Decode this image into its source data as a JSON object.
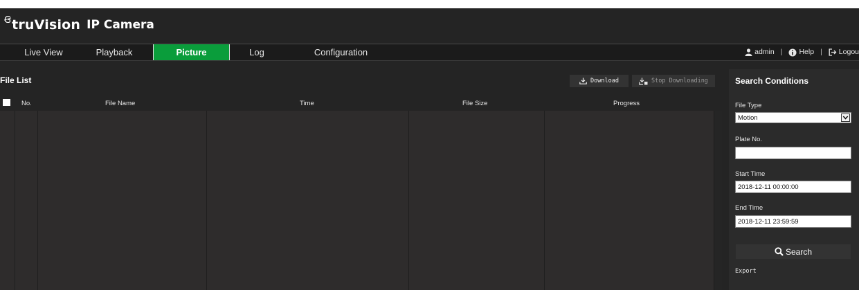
{
  "brand": {
    "logo_mark": "Ꞡ",
    "name": "truVision",
    "product": "IP Camera"
  },
  "nav": {
    "tabs": [
      {
        "label": "Live View"
      },
      {
        "label": "Playback"
      },
      {
        "label": "Picture"
      },
      {
        "label": "Log"
      },
      {
        "label": "Configuration"
      }
    ],
    "active_tab": "Picture",
    "user": "admin",
    "help": "Help",
    "logout": "Logou",
    "separator": "|"
  },
  "file_list": {
    "title": "File List",
    "download_label": "Download",
    "stop_label": "Stop Downloading",
    "columns": [
      "No.",
      "File Name",
      "Time",
      "File Size",
      "Progress"
    ],
    "rows": []
  },
  "search": {
    "title": "Search Conditions",
    "file_type_label": "File Type",
    "file_type_value": "Motion",
    "plate_label": "Plate No.",
    "plate_value": "",
    "start_label": "Start Time",
    "start_value": "2018-12-11 00:00:00",
    "end_label": "End Time",
    "end_value": "2018-12-11 23:59:59",
    "search_label": "Search",
    "export_label": "Export"
  },
  "colors": {
    "active_tab": "#0a9d3b",
    "background": "#242424",
    "panel": "#2b2b2b"
  }
}
